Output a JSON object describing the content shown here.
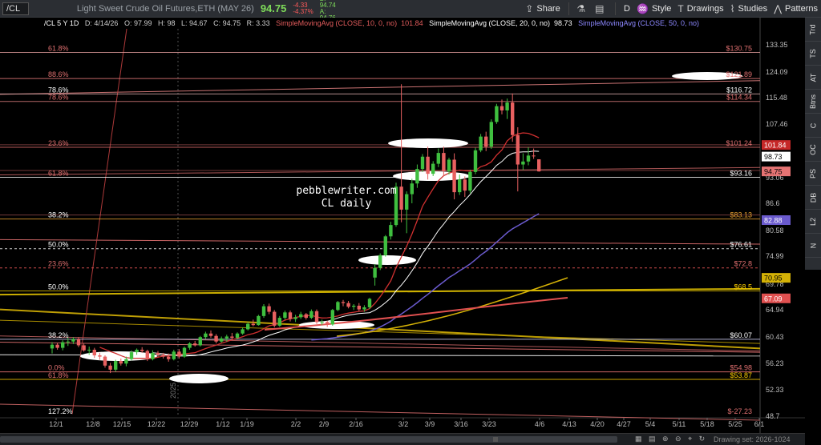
{
  "toolbar": {
    "symbol": "/CL",
    "description": "Light Sweet Crude Oil Futures,ETH (MAY 26)",
    "last": "94.75",
    "change": "-4.33",
    "change_pct": "-4.37%",
    "bid": "B: 94.74",
    "ask": "A: 94.76",
    "share": "Share",
    "period": "D",
    "style": "Style",
    "drawings": "Drawings",
    "studies": "Studies",
    "patterns": "Patterns"
  },
  "side_tabs": [
    "Trd",
    "TS",
    "AT",
    "Btns",
    "C",
    "OC",
    "PS",
    "DB",
    "L2",
    "N"
  ],
  "header": {
    "symbol_period": "/CL 5 Y 1D",
    "date": "D: 4/14/26",
    "open": "O: 97.99",
    "high": "H: 98",
    "low": "L: 94.67",
    "close": "C: 94.75",
    "range": "R: 3.33",
    "sma10": "SimpleMovingAvg (CLOSE, 10, 0, no)",
    "sma10_value": "101.84",
    "sma20": "SimpleMovingAvg (CLOSE, 20, 0, no)",
    "sma20_value": "98.73",
    "sma50": "SimpleMovingAvg (CLOSE, 50, 0, no)"
  },
  "annotation": {
    "line1": "pebblewriter.com",
    "line2": "CL daily"
  },
  "scrollbar": {
    "icons": "▦ ▤ ⊕ ⊖ ⌖ ↻",
    "drawing_set": "Drawing set: 2026-1024"
  },
  "chart_data": {
    "type": "candlestick",
    "ylim": [
      48.7,
      138.6
    ],
    "y_ticks": [
      {
        "value": 133.35,
        "label": "133.35"
      },
      {
        "value": 124.09,
        "label": "124.09"
      },
      {
        "value": 115.48,
        "label": "115.48"
      },
      {
        "value": 107.46,
        "label": "107.46"
      },
      {
        "value": 93.06,
        "label": "93.06"
      },
      {
        "value": 86.6,
        "label": "86.6"
      },
      {
        "value": 80.58,
        "label": "80.58"
      },
      {
        "value": 74.99,
        "label": "74.99"
      },
      {
        "value": 69.78,
        "label": "69.78"
      },
      {
        "value": 64.94,
        "label": "64.94"
      },
      {
        "value": 60.43,
        "label": "60.43"
      },
      {
        "value": 56.23,
        "label": "56.23"
      },
      {
        "value": 52.33,
        "label": "52.33"
      },
      {
        "value": 48.7,
        "label": "48.7"
      }
    ],
    "x_ticks": [
      "12/1",
      "12/8",
      "12/15",
      "12/22",
      "12/29",
      "1/12",
      "1/19",
      "2/2",
      "2/9",
      "2/16",
      "3/2",
      "3/9",
      "3/16",
      "3/23",
      "4/6",
      "4/13",
      "4/20",
      "4/27",
      "5/4",
      "5/11",
      "5/18",
      "5/25",
      "6/1"
    ],
    "year_label": "2025",
    "price_badges": [
      {
        "value": 101.84,
        "label": "101.84",
        "color": "#c62828",
        "text_color": "#ffffff"
      },
      {
        "value": 98.73,
        "label": "98.73",
        "color": "#ffffff",
        "text_color": "#000000"
      },
      {
        "value": 94.75,
        "label": "94.75",
        "color": "#e57373",
        "text_color": "#000000"
      },
      {
        "value": 82.88,
        "label": "82.88",
        "color": "#6a5acd",
        "text_color": "#ffffff"
      },
      {
        "value": 70.95,
        "label": "70.95",
        "color": "#d4b106",
        "text_color": "#000000"
      },
      {
        "value": 67.09,
        "label": "67.09",
        "color": "#e05050",
        "text_color": "#ffffff"
      }
    ],
    "levels_right": [
      {
        "value": 130.75,
        "label": "$130.75"
      },
      {
        "value": 121.89,
        "label": "$121.89"
      },
      {
        "value": 116.72,
        "label": "$116.72"
      },
      {
        "value": 114.34,
        "label": "$114.34"
      },
      {
        "value": 101.24,
        "label": "$101.24"
      },
      {
        "value": 93.16,
        "label": "$93.16"
      },
      {
        "value": 83.13,
        "label": "$83.13"
      },
      {
        "value": 76.61,
        "label": "$76.61"
      },
      {
        "value": 72.8,
        "label": "$72.8"
      },
      {
        "value": 68.5,
        "label": "$68.5"
      },
      {
        "value": 60.07,
        "label": "$60.07"
      },
      {
        "value": 54.98,
        "label": "$54.98"
      },
      {
        "value": 53.87,
        "label": "$53.87"
      },
      {
        "value": -27.23,
        "label": "$-27.23"
      }
    ],
    "levels_left": [
      {
        "value": 130.75,
        "label": "61.8%"
      },
      {
        "value": 121.89,
        "label": "88.6%"
      },
      {
        "value": 116.72,
        "label": "78.6%"
      },
      {
        "value": 114.34,
        "label": "78.6%"
      },
      {
        "value": 101.24,
        "label": "23.6%"
      },
      {
        "value": 93.16,
        "label": "61.8%"
      },
      {
        "value": 83.13,
        "label": "38.2%"
      },
      {
        "value": 76.61,
        "label": "50.0%"
      },
      {
        "value": 72.8,
        "label": "23.6%"
      },
      {
        "value": 68.5,
        "label": "50.0%"
      },
      {
        "value": 60.07,
        "label": "38.2%"
      },
      {
        "value": 54.98,
        "label": "0.0%"
      },
      {
        "value": 53.87,
        "label": "61.8%"
      },
      {
        "value": -27.23,
        "label": "127.2%"
      }
    ],
    "candles": [
      {
        "date": "12/1",
        "o": 58.6,
        "h": 59.6,
        "l": 57.8,
        "c": 59.2
      },
      {
        "date": "12/2",
        "o": 59.2,
        "h": 59.5,
        "l": 58.4,
        "c": 58.7
      },
      {
        "date": "12/3",
        "o": 58.7,
        "h": 59.9,
        "l": 58.3,
        "c": 59.6
      },
      {
        "date": "12/4",
        "o": 59.6,
        "h": 60.3,
        "l": 59.0,
        "c": 59.7
      },
      {
        "date": "12/5",
        "o": 59.7,
        "h": 60.4,
        "l": 59.3,
        "c": 60.1
      },
      {
        "date": "12/8",
        "o": 60.1,
        "h": 60.4,
        "l": 58.8,
        "c": 59.1
      },
      {
        "date": "12/9",
        "o": 59.1,
        "h": 59.4,
        "l": 58.1,
        "c": 58.3
      },
      {
        "date": "12/10",
        "o": 58.3,
        "h": 58.9,
        "l": 57.6,
        "c": 58.4
      },
      {
        "date": "12/11",
        "o": 58.4,
        "h": 58.7,
        "l": 57.1,
        "c": 57.5
      },
      {
        "date": "12/12",
        "o": 57.5,
        "h": 57.9,
        "l": 56.8,
        "c": 57.3
      },
      {
        "date": "12/15",
        "o": 57.3,
        "h": 57.5,
        "l": 55.6,
        "c": 55.9
      },
      {
        "date": "12/16",
        "o": 55.9,
        "h": 56.3,
        "l": 54.8,
        "c": 55.3
      },
      {
        "date": "12/17",
        "o": 55.3,
        "h": 56.8,
        "l": 55.0,
        "c": 56.6
      },
      {
        "date": "12/18",
        "o": 56.6,
        "h": 57.0,
        "l": 55.9,
        "c": 56.2
      },
      {
        "date": "12/19",
        "o": 56.2,
        "h": 57.3,
        "l": 55.8,
        "c": 56.9
      },
      {
        "date": "12/22",
        "o": 56.9,
        "h": 58.3,
        "l": 56.7,
        "c": 58.0
      },
      {
        "date": "12/23",
        "o": 58.0,
        "h": 58.6,
        "l": 57.6,
        "c": 58.4
      },
      {
        "date": "12/24",
        "o": 58.4,
        "h": 58.8,
        "l": 57.9,
        "c": 58.2
      },
      {
        "date": "12/26",
        "o": 58.2,
        "h": 58.4,
        "l": 56.6,
        "c": 56.9
      },
      {
        "date": "12/29",
        "o": 56.9,
        "h": 58.3,
        "l": 56.7,
        "c": 57.9
      },
      {
        "date": "12/30",
        "o": 57.9,
        "h": 58.2,
        "l": 57.2,
        "c": 57.6
      },
      {
        "date": "12/31",
        "o": 57.6,
        "h": 57.9,
        "l": 57.0,
        "c": 57.3
      },
      {
        "date": "1/2",
        "o": 57.3,
        "h": 57.8,
        "l": 56.5,
        "c": 56.9
      },
      {
        "date": "1/5",
        "o": 56.9,
        "h": 58.4,
        "l": 56.7,
        "c": 58.1
      },
      {
        "date": "1/6",
        "o": 58.1,
        "h": 58.5,
        "l": 57.0,
        "c": 57.3
      },
      {
        "date": "1/7",
        "o": 57.3,
        "h": 58.9,
        "l": 57.1,
        "c": 58.7
      },
      {
        "date": "1/8",
        "o": 58.7,
        "h": 59.6,
        "l": 58.4,
        "c": 59.4
      },
      {
        "date": "1/9",
        "o": 59.4,
        "h": 59.8,
        "l": 58.9,
        "c": 59.1
      },
      {
        "date": "1/12",
        "o": 59.1,
        "h": 60.6,
        "l": 58.9,
        "c": 60.4
      },
      {
        "date": "1/13",
        "o": 60.4,
        "h": 61.3,
        "l": 60.1,
        "c": 61.0
      },
      {
        "date": "1/14",
        "o": 61.0,
        "h": 61.5,
        "l": 60.3,
        "c": 60.6
      },
      {
        "date": "1/15",
        "o": 60.6,
        "h": 60.9,
        "l": 59.4,
        "c": 59.7
      },
      {
        "date": "1/16",
        "o": 59.7,
        "h": 60.5,
        "l": 59.5,
        "c": 60.2
      },
      {
        "date": "1/20",
        "o": 60.2,
        "h": 60.8,
        "l": 59.7,
        "c": 60.5
      },
      {
        "date": "1/21",
        "o": 60.5,
        "h": 61.1,
        "l": 60.0,
        "c": 60.3
      },
      {
        "date": "1/22",
        "o": 60.3,
        "h": 61.2,
        "l": 60.1,
        "c": 61.0
      },
      {
        "date": "1/23",
        "o": 61.0,
        "h": 62.0,
        "l": 60.8,
        "c": 61.7
      },
      {
        "date": "1/26",
        "o": 61.7,
        "h": 62.9,
        "l": 61.5,
        "c": 62.6
      },
      {
        "date": "1/27",
        "o": 62.6,
        "h": 63.3,
        "l": 62.2,
        "c": 62.4
      },
      {
        "date": "1/28",
        "o": 62.4,
        "h": 64.1,
        "l": 62.3,
        "c": 63.9
      },
      {
        "date": "1/29",
        "o": 63.9,
        "h": 66.0,
        "l": 63.6,
        "c": 65.6
      },
      {
        "date": "1/30",
        "o": 65.6,
        "h": 66.1,
        "l": 64.2,
        "c": 64.6
      },
      {
        "date": "2/2",
        "o": 64.6,
        "h": 64.9,
        "l": 62.0,
        "c": 62.3
      },
      {
        "date": "2/3",
        "o": 62.3,
        "h": 63.9,
        "l": 62.1,
        "c": 63.6
      },
      {
        "date": "2/4",
        "o": 63.6,
        "h": 64.8,
        "l": 63.3,
        "c": 64.5
      },
      {
        "date": "2/5",
        "o": 64.5,
        "h": 64.8,
        "l": 63.0,
        "c": 63.4
      },
      {
        "date": "2/6",
        "o": 63.4,
        "h": 64.1,
        "l": 62.9,
        "c": 63.7
      },
      {
        "date": "2/9",
        "o": 63.7,
        "h": 64.6,
        "l": 63.4,
        "c": 64.2
      },
      {
        "date": "2/10",
        "o": 64.2,
        "h": 64.4,
        "l": 63.3,
        "c": 63.6
      },
      {
        "date": "2/11",
        "o": 63.6,
        "h": 65.0,
        "l": 63.4,
        "c": 64.7
      },
      {
        "date": "2/12",
        "o": 64.7,
        "h": 65.0,
        "l": 62.6,
        "c": 62.9
      },
      {
        "date": "2/13",
        "o": 62.9,
        "h": 63.3,
        "l": 62.4,
        "c": 62.9
      },
      {
        "date": "2/17",
        "o": 62.9,
        "h": 63.1,
        "l": 62.1,
        "c": 62.5
      },
      {
        "date": "2/18",
        "o": 62.5,
        "h": 65.1,
        "l": 62.3,
        "c": 64.9
      },
      {
        "date": "2/19",
        "o": 64.9,
        "h": 66.6,
        "l": 64.7,
        "c": 66.4
      },
      {
        "date": "2/20",
        "o": 66.4,
        "h": 66.8,
        "l": 65.6,
        "c": 66.2
      },
      {
        "date": "2/23",
        "o": 66.2,
        "h": 66.6,
        "l": 65.2,
        "c": 65.5
      },
      {
        "date": "2/24",
        "o": 65.5,
        "h": 66.0,
        "l": 64.9,
        "c": 65.7
      },
      {
        "date": "2/25",
        "o": 65.7,
        "h": 66.2,
        "l": 64.7,
        "c": 65.0
      },
      {
        "date": "2/26",
        "o": 65.0,
        "h": 65.8,
        "l": 64.6,
        "c": 65.4
      },
      {
        "date": "2/27",
        "o": 65.4,
        "h": 67.2,
        "l": 65.1,
        "c": 67.0
      },
      {
        "date": "3/2",
        "o": 71.0,
        "h": 73.5,
        "l": 69.5,
        "c": 72.8
      },
      {
        "date": "3/3",
        "o": 72.8,
        "h": 75.6,
        "l": 72.4,
        "c": 75.2
      },
      {
        "date": "3/4",
        "o": 75.2,
        "h": 79.6,
        "l": 74.9,
        "c": 79.3
      },
      {
        "date": "3/5",
        "o": 79.3,
        "h": 82.5,
        "l": 78.6,
        "c": 81.8
      },
      {
        "date": "3/6",
        "o": 81.8,
        "h": 91.8,
        "l": 81.4,
        "c": 90.8
      },
      {
        "date": "3/9",
        "o": 90.8,
        "h": 120.0,
        "l": 82.4,
        "c": 85.2
      },
      {
        "date": "3/10",
        "o": 85.2,
        "h": 89.6,
        "l": 80.0,
        "c": 88.9
      },
      {
        "date": "3/11",
        "o": 88.9,
        "h": 92.8,
        "l": 86.6,
        "c": 91.6
      },
      {
        "date": "3/12",
        "o": 91.6,
        "h": 96.6,
        "l": 90.5,
        "c": 95.4
      },
      {
        "date": "3/13",
        "o": 95.4,
        "h": 99.4,
        "l": 94.6,
        "c": 98.7
      },
      {
        "date": "3/16",
        "o": 98.7,
        "h": 101.4,
        "l": 92.6,
        "c": 94.1
      },
      {
        "date": "3/17",
        "o": 94.1,
        "h": 97.5,
        "l": 93.5,
        "c": 96.8
      },
      {
        "date": "3/18",
        "o": 96.8,
        "h": 100.9,
        "l": 95.9,
        "c": 99.7
      },
      {
        "date": "3/19",
        "o": 99.7,
        "h": 101.4,
        "l": 93.6,
        "c": 94.8
      },
      {
        "date": "3/20",
        "o": 94.8,
        "h": 98.4,
        "l": 93.9,
        "c": 97.9
      },
      {
        "date": "3/23",
        "o": 97.9,
        "h": 99.6,
        "l": 87.6,
        "c": 89.4
      },
      {
        "date": "3/24",
        "o": 89.4,
        "h": 93.9,
        "l": 88.7,
        "c": 92.6
      },
      {
        "date": "3/25",
        "o": 92.6,
        "h": 93.4,
        "l": 88.2,
        "c": 89.8
      },
      {
        "date": "3/26",
        "o": 89.8,
        "h": 95.2,
        "l": 89.1,
        "c": 94.6
      },
      {
        "date": "3/27",
        "o": 94.6,
        "h": 101.1,
        "l": 94.0,
        "c": 100.4
      },
      {
        "date": "3/30",
        "o": 100.4,
        "h": 104.8,
        "l": 99.9,
        "c": 104.1
      },
      {
        "date": "3/31",
        "o": 104.1,
        "h": 105.4,
        "l": 100.2,
        "c": 101.4
      },
      {
        "date": "4/1",
        "o": 101.4,
        "h": 108.9,
        "l": 100.8,
        "c": 108.1
      },
      {
        "date": "4/2",
        "o": 108.1,
        "h": 113.6,
        "l": 107.5,
        "c": 112.9
      },
      {
        "date": "4/3",
        "o": 112.9,
        "h": 114.9,
        "l": 110.4,
        "c": 111.6
      },
      {
        "date": "4/6",
        "o": 111.6,
        "h": 115.2,
        "l": 109.0,
        "c": 114.0
      },
      {
        "date": "4/7",
        "o": 114.0,
        "h": 116.9,
        "l": 102.7,
        "c": 104.5
      },
      {
        "date": "4/8",
        "o": 104.5,
        "h": 106.6,
        "l": 89.6,
        "c": 96.6
      },
      {
        "date": "4/9",
        "o": 96.6,
        "h": 99.6,
        "l": 95.1,
        "c": 97.4
      },
      {
        "date": "4/10",
        "o": 97.4,
        "h": 101.2,
        "l": 96.4,
        "c": 99.0
      },
      {
        "date": "4/13",
        "o": 99.0,
        "h": 100.9,
        "l": 98.1,
        "c": 98.9
      },
      {
        "date": "4/14",
        "o": 97.99,
        "h": 98.0,
        "l": 94.67,
        "c": 94.75
      }
    ]
  }
}
